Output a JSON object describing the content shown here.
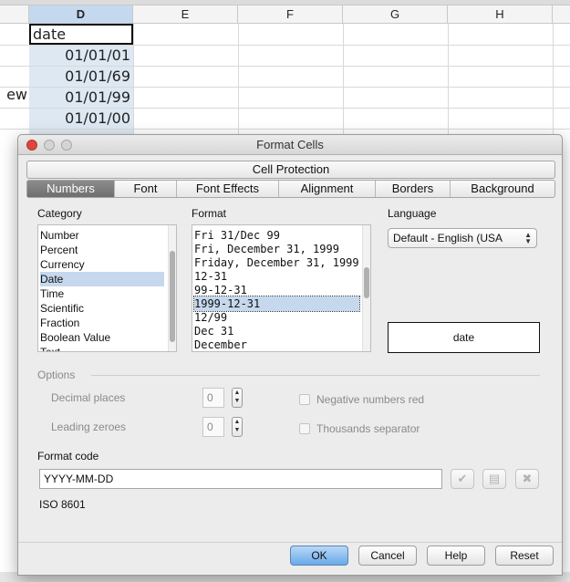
{
  "sheet": {
    "columns": [
      "D",
      "E",
      "F",
      "G",
      "H"
    ],
    "cells_d": [
      "date",
      "01/01/01",
      "01/01/69",
      "01/01/99",
      "01/01/00"
    ],
    "partial_c": "ew"
  },
  "dialog": {
    "title": "Format Cells",
    "tabs_row1": [
      "Cell Protection"
    ],
    "tabs_row2": [
      "Numbers",
      "Font",
      "Font Effects",
      "Alignment",
      "Borders",
      "Background"
    ],
    "selected_tab": "Numbers",
    "category_label": "Category",
    "category_items": [
      "Number",
      "Percent",
      "Currency",
      "Date",
      "Time",
      "Scientific",
      "Fraction",
      "Boolean Value",
      "Text"
    ],
    "category_selected": "Date",
    "format_label": "Format",
    "format_items": [
      "Fri 31/Dec 99",
      "Fri, December 31, 1999",
      "Friday, December 31, 1999",
      "12-31",
      "99-12-31",
      "1999-12-31",
      "12/99",
      "Dec 31",
      "December"
    ],
    "format_selected": "1999-12-31",
    "language_label": "Language",
    "language_value": "Default - English (USA",
    "preview_text": "date",
    "options_label": "Options",
    "decimal_places_label": "Decimal places",
    "decimal_places_value": "0",
    "leading_zeroes_label": "Leading zeroes",
    "leading_zeroes_value": "0",
    "negative_red_label": "Negative numbers red",
    "thousands_sep_label": "Thousands separator",
    "format_code_label": "Format code",
    "format_code_value": "YYYY-MM-DD",
    "format_comment": "ISO 8601",
    "buttons": {
      "ok": "OK",
      "cancel": "Cancel",
      "help": "Help",
      "reset": "Reset"
    }
  }
}
